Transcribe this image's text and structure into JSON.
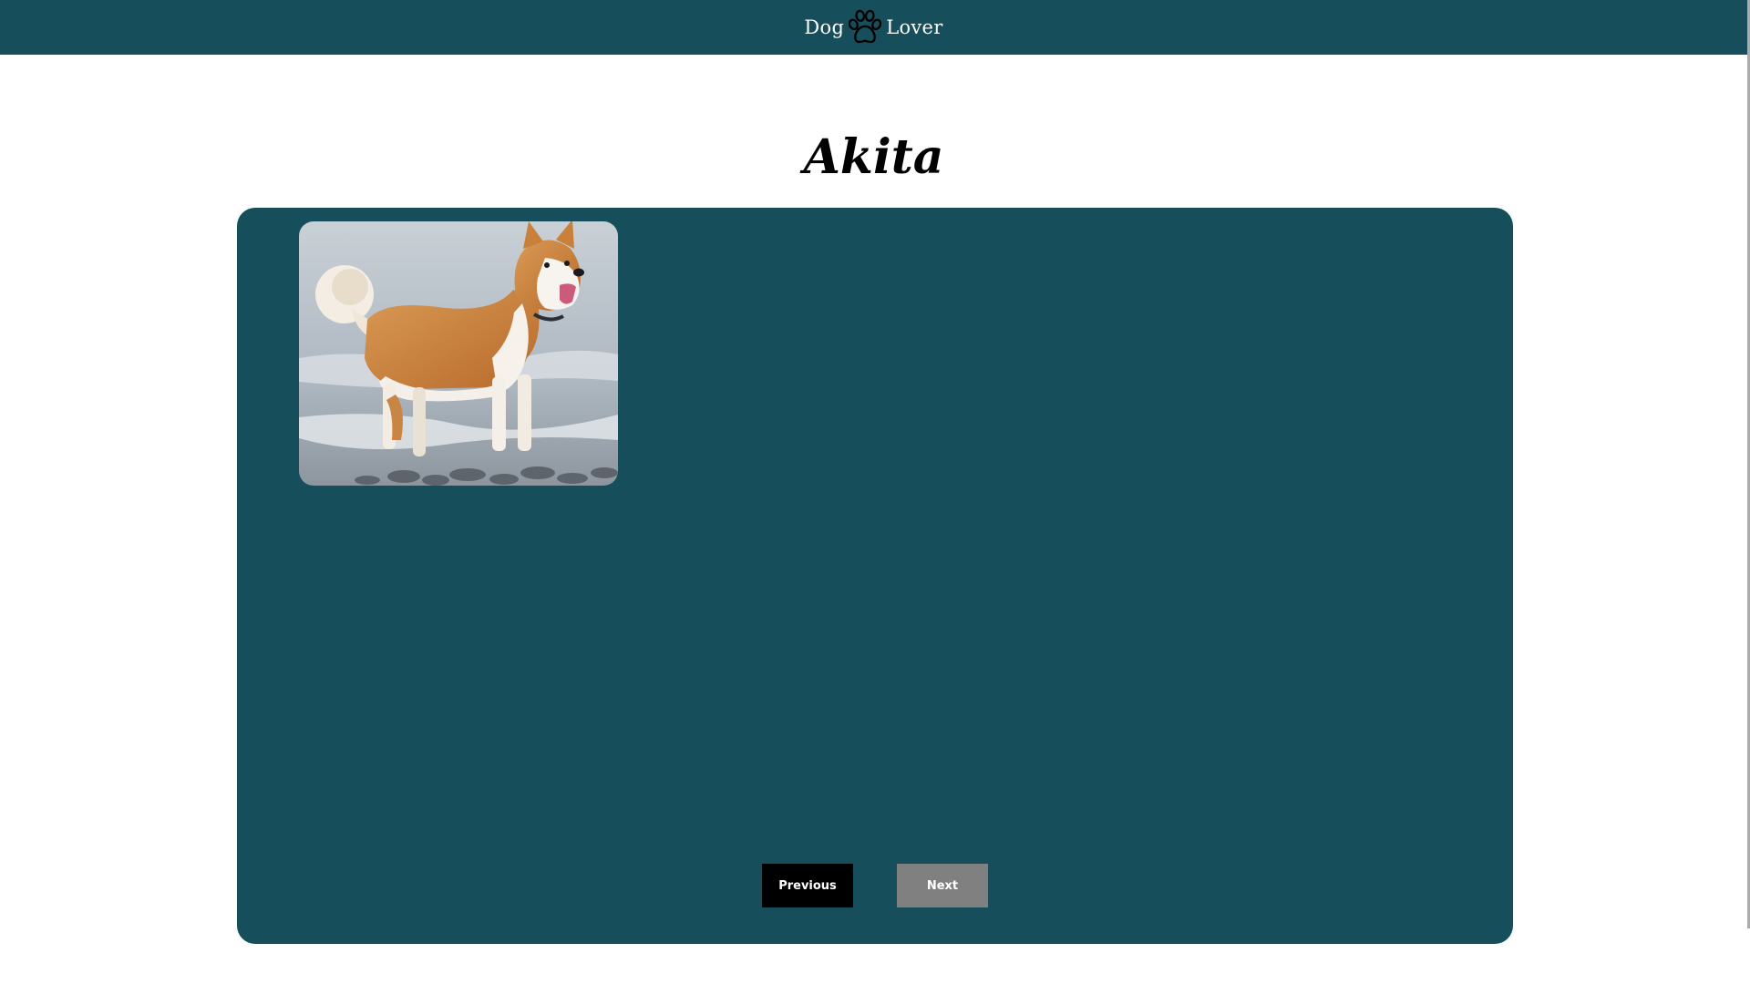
{
  "header": {
    "brand_left": "Dog",
    "brand_right": "Lover",
    "logo_icon": "paw-icon",
    "background": "#164e5c"
  },
  "page": {
    "title": "Akita"
  },
  "card": {
    "background": "#164e5c",
    "image_subject": "akita-dog-photo"
  },
  "nav": {
    "previous_label": "Previous",
    "next_label": "Next",
    "previous_color": "#000000",
    "next_color": "#808080"
  }
}
